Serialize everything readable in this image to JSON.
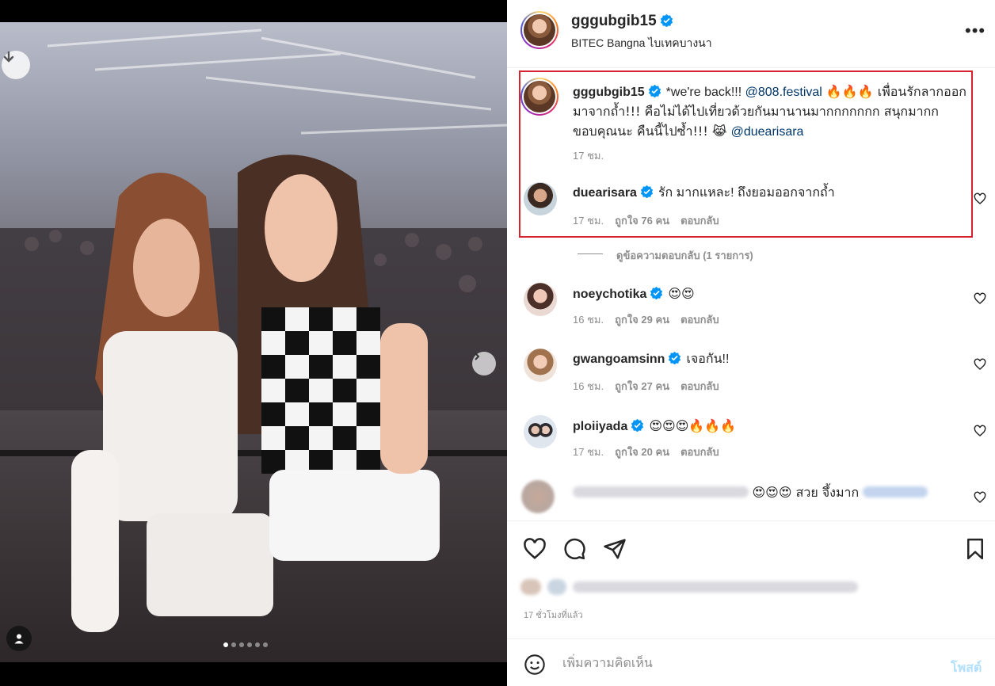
{
  "post": {
    "image_dots_count": 6,
    "image_active_dot": 0,
    "icons": {
      "download": "arrow-down-icon",
      "next": "chevron-right-icon",
      "tagged_users": "person-icon"
    }
  },
  "header": {
    "username": "gggubgib15",
    "verified": true,
    "location": "BITEC Bangna ไบเทคบางนา",
    "more_label": "•••"
  },
  "caption": {
    "username": "gggubgib15",
    "text_1": "*we're back!!! ",
    "mention_1": "@808.festival",
    "text_2": " 🔥🔥🔥 เพื่อนรักลากออกมาจากถ้ำ!!! คือไม่ได้ไปเที่ยวด้วยกันมานานมากกกกกกก สนุกมากกขอบคุณนะ คืนนี้ไปซ้ำ!!! 😹 ",
    "mention_2": "@duearisara",
    "time": "17 ชม."
  },
  "comments": [
    {
      "username": "duearisara",
      "text": "รัก มากแหละ! ถึงยอมออกจากถ้ำ",
      "time": "17 ชม.",
      "likes": "ถูกใจ 76 คน",
      "reply": "ตอบกลับ"
    },
    {
      "username": "noeychotika",
      "text": "😍😍",
      "time": "16 ชม.",
      "likes": "ถูกใจ 29 คน",
      "reply": "ตอบกลับ"
    },
    {
      "username": "gwangoamsinn",
      "text": "เจอกัน!!",
      "time": "16 ชม.",
      "likes": "ถูกใจ 27 คน",
      "reply": "ตอบกลับ"
    },
    {
      "username": "ploiiyada",
      "text": "😍😍😍🔥🔥🔥",
      "time": "17 ชม.",
      "likes": "ถูกใจ 20 คน",
      "reply": "ตอบกลับ"
    },
    {
      "text": "😍😍😍 สวย จึ้งมาก"
    }
  ],
  "view_replies": "ดูข้อความตอบกลับ (1 รายการ)",
  "actions": {
    "like_icon": "heart-icon",
    "comment_icon": "comment-bubble-icon",
    "share_icon": "paper-plane-icon",
    "save_icon": "bookmark-icon"
  },
  "posted_ago": "17 ชั่วโมงที่แล้ว",
  "add_comment": {
    "placeholder": "เพิ่มความคิดเห็น",
    "post_label": "โพสต์",
    "emoji_icon": "smiley-icon"
  },
  "colors": {
    "highlight_border": "#d6222c",
    "verified_badge": "#0095f6",
    "link": "#00376b",
    "post_button_disabled": "#b2dffc"
  }
}
